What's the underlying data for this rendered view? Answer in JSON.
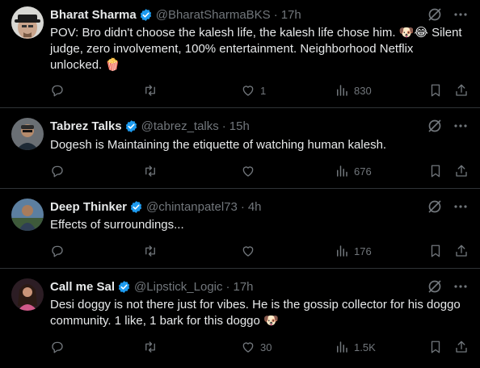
{
  "tweets": [
    {
      "name": "Bharat Sharma",
      "handle": "@BharatSharmaBKS",
      "time": "17h",
      "text": "POV: Bro didn't choose the kalesh life, the kalesh life chose him. 🐶😂 Silent judge, zero involvement, 100% entertainment. Neighborhood Netflix unlocked. 🍿",
      "replies": "",
      "retweets": "",
      "likes": "1",
      "views": "830"
    },
    {
      "name": "Tabrez Talks",
      "handle": "@tabrez_talks",
      "time": "15h",
      "text": "Dogesh is Maintaining the etiquette of watching human kalesh.",
      "replies": "",
      "retweets": "",
      "likes": "",
      "views": "676"
    },
    {
      "name": "Deep Thinker",
      "handle": "@chintanpatel73",
      "time": "4h",
      "text": "Effects of surroundings...",
      "replies": "",
      "retweets": "",
      "likes": "",
      "views": "176"
    },
    {
      "name": "Call me Sal",
      "handle": "@Lipstick_Logic",
      "time": "17h",
      "text": "Desi doggy is not there just for vibes. He is the gossip collector for his doggo community. 1 like, 1 bark for this doggo 🐶",
      "replies": "",
      "retweets": "",
      "likes": "30",
      "views": "1.5K"
    }
  ],
  "colors": {
    "background": "#000000",
    "text": "#e7e9ea",
    "muted": "#71767b",
    "divider": "#2f3336",
    "verified": "#1d9bf0"
  },
  "icons": {
    "reply": "reply-icon",
    "retweet": "retweet-icon",
    "like": "heart-icon",
    "views": "analytics-icon",
    "bookmark": "bookmark-icon",
    "share": "share-icon",
    "grok": "grok-icon",
    "more": "more-icon",
    "verified": "verified-badge-icon"
  }
}
